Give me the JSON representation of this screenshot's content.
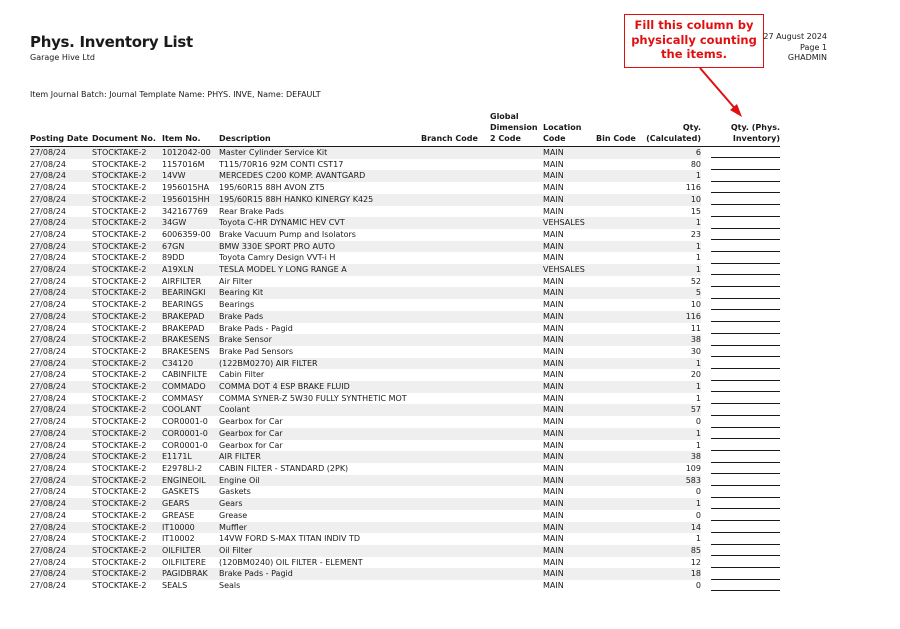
{
  "report": {
    "title": "Phys. Inventory List",
    "company": "Garage Hive Ltd",
    "date": "27 August 2024",
    "page": "Page 1",
    "user": "GHADMIN",
    "batch_line": "Item Journal Batch: Journal Template Name: PHYS. INVE, Name: DEFAULT"
  },
  "callout": {
    "lines": [
      "Fill this column by",
      "physically counting",
      "the items."
    ],
    "color": "#e01010"
  },
  "columns": [
    "Posting Date",
    "Document No.",
    "Item No.",
    "Description",
    "Branch Code",
    "Global Dimension 2 Code",
    "Location Code",
    "Bin Code",
    "Qty. (Calculated)",
    "Qty. (Phys. Inventory)"
  ],
  "rows": [
    [
      "27/08/24",
      "STOCKTAKE-2",
      "1012042-00",
      "Master Cylinder Service Kit",
      "",
      "",
      "MAIN",
      "",
      "6"
    ],
    [
      "27/08/24",
      "STOCKTAKE-2",
      "1157016M",
      "T115/70R16 92M CONTI CST17",
      "",
      "",
      "MAIN",
      "",
      "80"
    ],
    [
      "27/08/24",
      "STOCKTAKE-2",
      "14VW",
      "MERCEDES C200 KOMP. AVANTGARD",
      "",
      "",
      "MAIN",
      "",
      "1"
    ],
    [
      "27/08/24",
      "STOCKTAKE-2",
      "1956015HA",
      "195/60R15 88H AVON ZT5",
      "",
      "",
      "MAIN",
      "",
      "116"
    ],
    [
      "27/08/24",
      "STOCKTAKE-2",
      "1956015HH",
      "195/60R15 88H HANKO KINERGY K425",
      "",
      "",
      "MAIN",
      "",
      "10"
    ],
    [
      "27/08/24",
      "STOCKTAKE-2",
      "342167769",
      "Rear Brake Pads",
      "",
      "",
      "MAIN",
      "",
      "15"
    ],
    [
      "27/08/24",
      "STOCKTAKE-2",
      "34GW",
      "Toyota C-HR DYNAMIC HEV CVT",
      "",
      "",
      "VEHSALES",
      "",
      "1"
    ],
    [
      "27/08/24",
      "STOCKTAKE-2",
      "6006359-00",
      "Brake Vacuum Pump and Isolators",
      "",
      "",
      "MAIN",
      "",
      "23"
    ],
    [
      "27/08/24",
      "STOCKTAKE-2",
      "67GN",
      "BMW 330E SPORT PRO AUTO",
      "",
      "",
      "MAIN",
      "",
      "1"
    ],
    [
      "27/08/24",
      "STOCKTAKE-2",
      "89DD",
      "Toyota Camry Design VVT-i H",
      "",
      "",
      "MAIN",
      "",
      "1"
    ],
    [
      "27/08/24",
      "STOCKTAKE-2",
      "A19XLN",
      "TESLA MODEL Y LONG RANGE A",
      "",
      "",
      "VEHSALES",
      "",
      "1"
    ],
    [
      "27/08/24",
      "STOCKTAKE-2",
      "AIRFILTER",
      "Air Filter",
      "",
      "",
      "MAIN",
      "",
      "52"
    ],
    [
      "27/08/24",
      "STOCKTAKE-2",
      "BEARINGKI",
      "Bearing Kit",
      "",
      "",
      "MAIN",
      "",
      "5"
    ],
    [
      "27/08/24",
      "STOCKTAKE-2",
      "BEARINGS",
      "Bearings",
      "",
      "",
      "MAIN",
      "",
      "10"
    ],
    [
      "27/08/24",
      "STOCKTAKE-2",
      "BRAKEPAD",
      "Brake Pads",
      "",
      "",
      "MAIN",
      "",
      "116"
    ],
    [
      "27/08/24",
      "STOCKTAKE-2",
      "BRAKEPAD",
      "Brake Pads - Pagid",
      "",
      "",
      "MAIN",
      "",
      "11"
    ],
    [
      "27/08/24",
      "STOCKTAKE-2",
      "BRAKESENS",
      "Brake Sensor",
      "",
      "",
      "MAIN",
      "",
      "38"
    ],
    [
      "27/08/24",
      "STOCKTAKE-2",
      "BRAKESENS",
      "Brake Pad Sensors",
      "",
      "",
      "MAIN",
      "",
      "30"
    ],
    [
      "27/08/24",
      "STOCKTAKE-2",
      "C34120",
      "(122BM0270) AIR FILTER",
      "",
      "",
      "MAIN",
      "",
      "1"
    ],
    [
      "27/08/24",
      "STOCKTAKE-2",
      "CABINFILTE",
      "Cabin Filter",
      "",
      "",
      "MAIN",
      "",
      "20"
    ],
    [
      "27/08/24",
      "STOCKTAKE-2",
      "COMMADO",
      "COMMA DOT 4 ESP BRAKE FLUID",
      "",
      "",
      "MAIN",
      "",
      "1"
    ],
    [
      "27/08/24",
      "STOCKTAKE-2",
      "COMMASY",
      "COMMA SYNER-Z 5W30 FULLY SYNTHETIC MOT",
      "",
      "",
      "MAIN",
      "",
      "1"
    ],
    [
      "27/08/24",
      "STOCKTAKE-2",
      "COOLANT",
      "Coolant",
      "",
      "",
      "MAIN",
      "",
      "57"
    ],
    [
      "27/08/24",
      "STOCKTAKE-2",
      "COR0001-0",
      "Gearbox for Car",
      "",
      "",
      "MAIN",
      "",
      "0"
    ],
    [
      "27/08/24",
      "STOCKTAKE-2",
      "COR0001-0",
      "Gearbox for Car",
      "",
      "",
      "MAIN",
      "",
      "1"
    ],
    [
      "27/08/24",
      "STOCKTAKE-2",
      "COR0001-0",
      "Gearbox for Car",
      "",
      "",
      "MAIN",
      "",
      "1"
    ],
    [
      "27/08/24",
      "STOCKTAKE-2",
      "E1171L",
      "AIR FILTER",
      "",
      "",
      "MAIN",
      "",
      "38"
    ],
    [
      "27/08/24",
      "STOCKTAKE-2",
      "E2978LI-2",
      "CABIN FILTER - STANDARD (2PK)",
      "",
      "",
      "MAIN",
      "",
      "109"
    ],
    [
      "27/08/24",
      "STOCKTAKE-2",
      "ENGINEOIL",
      "Engine Oil",
      "",
      "",
      "MAIN",
      "",
      "583"
    ],
    [
      "27/08/24",
      "STOCKTAKE-2",
      "GASKETS",
      "Gaskets",
      "",
      "",
      "MAIN",
      "",
      "0"
    ],
    [
      "27/08/24",
      "STOCKTAKE-2",
      "GEARS",
      "Gears",
      "",
      "",
      "MAIN",
      "",
      "1"
    ],
    [
      "27/08/24",
      "STOCKTAKE-2",
      "GREASE",
      "Grease",
      "",
      "",
      "MAIN",
      "",
      "0"
    ],
    [
      "27/08/24",
      "STOCKTAKE-2",
      "IT10000",
      "Muffler",
      "",
      "",
      "MAIN",
      "",
      "14"
    ],
    [
      "27/08/24",
      "STOCKTAKE-2",
      "IT10002",
      "14VW FORD S-MAX TITAN INDIV TD",
      "",
      "",
      "MAIN",
      "",
      "1"
    ],
    [
      "27/08/24",
      "STOCKTAKE-2",
      "OILFILTER",
      "Oil Filter",
      "",
      "",
      "MAIN",
      "",
      "85"
    ],
    [
      "27/08/24",
      "STOCKTAKE-2",
      "OILFILTERE",
      "(120BM0240) OIL FILTER - ELEMENT",
      "",
      "",
      "MAIN",
      "",
      "12"
    ],
    [
      "27/08/24",
      "STOCKTAKE-2",
      "PAGIDBRAK",
      "Brake Pads - Pagid",
      "",
      "",
      "MAIN",
      "",
      "18"
    ],
    [
      "27/08/24",
      "STOCKTAKE-2",
      "SEALS",
      "Seals",
      "",
      "",
      "MAIN",
      "",
      "0"
    ]
  ]
}
